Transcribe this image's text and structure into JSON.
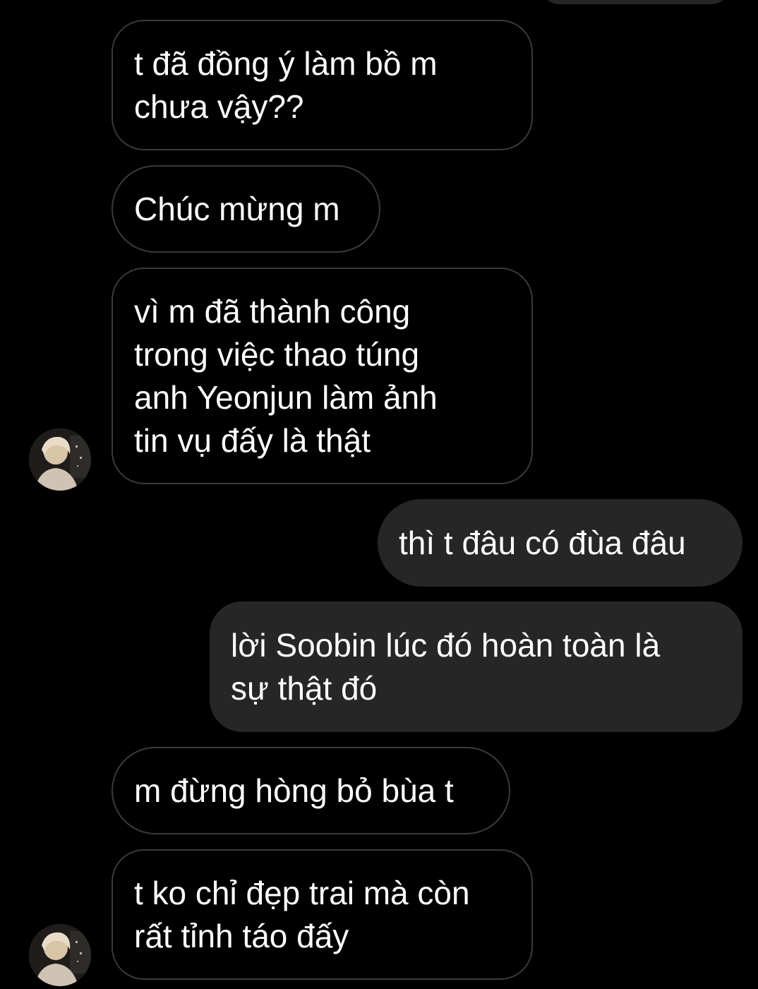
{
  "conversation": {
    "messages": [
      {
        "direction": "received",
        "text": "t đã đồng ý làm bồ m\nchưa vậy??"
      },
      {
        "direction": "received",
        "text": "Chúc mừng m"
      },
      {
        "direction": "received",
        "text": "vì m đã thành công\ntrong việc thao túng\nanh Yeonjun làm ảnh\ntin vụ đấy là thật"
      },
      {
        "direction": "sent",
        "text": "thì t đâu có đùa đâu"
      },
      {
        "direction": "sent",
        "text": "lời Soobin lúc đó hoàn toàn là\nsự thật đó"
      },
      {
        "direction": "received",
        "text": "m đừng hòng bỏ bùa t"
      },
      {
        "direction": "received",
        "text": "t ko chỉ đẹp trai mà còn\nrất tỉnh táo đấy"
      }
    ]
  },
  "colors": {
    "background": "#000000",
    "received_border": "#3a3a3a",
    "sent_bubble": "#262626",
    "text": "#ffffff"
  },
  "icons": {
    "avatar": "contact-avatar-photo"
  }
}
